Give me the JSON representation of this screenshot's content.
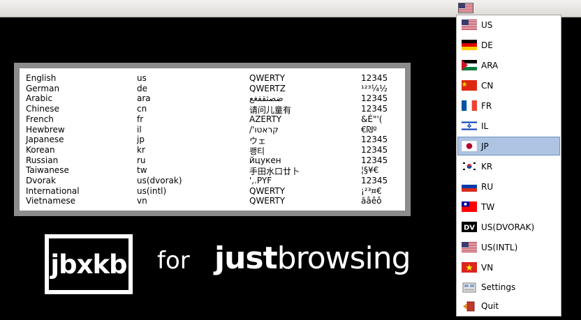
{
  "tray": {
    "current_flag": "us-flag-icon"
  },
  "table": {
    "rows": [
      [
        "English",
        "us",
        "QWERTY",
        "12345"
      ],
      [
        "German",
        "de",
        "QWERTZ",
        "¹²³¼½"
      ],
      [
        "Arabic",
        "ara",
        "ضصثقفغع",
        "12345"
      ],
      [
        "Chinese",
        "cn",
        "请问儿童有",
        "12345"
      ],
      [
        "French",
        "fr",
        "AZERTY",
        "&É\"'("
      ],
      [
        "Hewbrew",
        "il",
        "/'קראטו",
        "€₪º"
      ],
      [
        "Japanese",
        "jp",
        "ウェ",
        "12345"
      ],
      [
        "Korean",
        "kr",
        "쾡티",
        "12345"
      ],
      [
        "Russian",
        "ru",
        "йцукен",
        "12345"
      ],
      [
        "Taiwanese",
        "tw",
        "手田水口廿卜",
        "¦§¥€"
      ],
      [
        "Dvorak",
        "us(dvorak)",
        "',.PYF",
        "12345"
      ],
      [
        "International",
        "us(intl)",
        "QWERTY",
        "¡²³¤€"
      ],
      [
        "Vietnamese",
        "vn",
        "QWERTY",
        "ăâêô"
      ]
    ]
  },
  "logo": {
    "text": "jbxkb"
  },
  "tagline": {
    "for": "for",
    "brand_bold": "just",
    "brand_thin": "browsing"
  },
  "menu": {
    "items": [
      {
        "label": "US",
        "icon": "us-flag-icon"
      },
      {
        "label": "DE",
        "icon": "de-flag-icon"
      },
      {
        "label": "ARA",
        "icon": "ara-flag-icon"
      },
      {
        "label": "CN",
        "icon": "cn-flag-icon"
      },
      {
        "label": "FR",
        "icon": "fr-flag-icon"
      },
      {
        "label": "IL",
        "icon": "il-flag-icon"
      },
      {
        "label": "JP",
        "icon": "jp-flag-icon"
      },
      {
        "label": "KR",
        "icon": "kr-flag-icon"
      },
      {
        "label": "RU",
        "icon": "ru-flag-icon"
      },
      {
        "label": "TW",
        "icon": "tw-flag-icon"
      },
      {
        "label": "US(DVORAK)",
        "icon": "dvorak-icon"
      },
      {
        "label": "US(INTL)",
        "icon": "us-flag-icon"
      },
      {
        "label": "VN",
        "icon": "vn-flag-icon"
      },
      {
        "label": "Settings",
        "icon": "settings-icon"
      },
      {
        "label": "Quit",
        "icon": "quit-icon"
      }
    ],
    "selected": "JP"
  },
  "colors": {
    "selection_bg": "#adc4e3",
    "frame": "#8c8c8c",
    "background": "#000000"
  }
}
